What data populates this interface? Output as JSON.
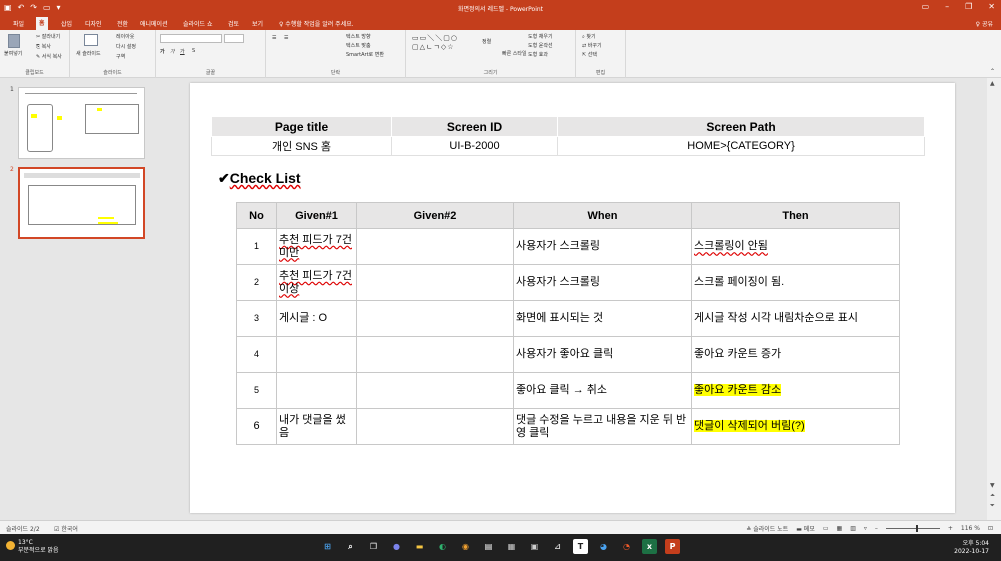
{
  "window": {
    "title": "화면정의서 레드벨 - PowerPoint"
  },
  "ribbon_tabs": [
    "파일",
    "홈",
    "삽입",
    "디자인",
    "전환",
    "애니메이션",
    "슬라이드 쇼",
    "검토",
    "보기"
  ],
  "tell_me": "♀ 수행할 작업을 알려 주세요.",
  "share": "♀ 공유",
  "ribbon": {
    "clipboard": {
      "label": "클립보드",
      "paste": "붙여넣기",
      "cut": "잘라내기",
      "copy": "복사",
      "format": "서식 복사"
    },
    "slides": {
      "label": "슬라이드",
      "new": "새 슬라이드",
      "layout": "레이아웃",
      "reset": "다시 설정",
      "section": "구역"
    },
    "font": {
      "label": "글꼴"
    },
    "paragraph": {
      "label": "단락",
      "text_direction": "텍스트 방향",
      "align_text": "텍스트 맞춤",
      "smartart": "SmartArt로 변환"
    },
    "drawing": {
      "label": "그리기",
      "arrange": "정렬",
      "quick_styles": "빠른 스타일",
      "fill": "도형 채우기",
      "outline": "도형 윤곽선",
      "effects": "도형 효과"
    },
    "editing": {
      "label": "편집",
      "find": "찾기",
      "replace": "바꾸기",
      "select": "선택"
    }
  },
  "thumbnails": [
    {
      "num": "1"
    },
    {
      "num": "2"
    }
  ],
  "slide": {
    "header_table": {
      "headers": [
        "Page title",
        "Screen ID",
        "Screen Path"
      ],
      "values": [
        "개인 SNS 홈",
        "UI-B-2000",
        "HOME>{CATEGORY}"
      ]
    },
    "checklist_title": "Check List",
    "checklist_mark": "✔",
    "checklist": {
      "headers": [
        "No",
        "Given#1",
        "Given#2",
        "When",
        "Then"
      ],
      "rows": [
        {
          "no": "1",
          "given1": "추천 피드가 7건 미만",
          "given2": "",
          "when": "사용자가 스크롤링",
          "then": "스크롤링이 안됨"
        },
        {
          "no": "2",
          "given1": "추천 피드가 7건 이상",
          "given2": "",
          "when": "사용자가 스크롤링",
          "then": "스크롤 페이징이 됨."
        },
        {
          "no": "3",
          "given1": "게시글 : O",
          "given2": "",
          "when": "화면에 표시되는 것",
          "then": "게시글 작성 시각 내림차순으로 표시"
        },
        {
          "no": "4",
          "given1": "",
          "given2": "",
          "when": "사용자가 좋아요 클릭",
          "then": "좋아요 카운트 증가"
        },
        {
          "no": "5",
          "given1": "",
          "given2": "",
          "when": "좋아요 클릭 → 취소",
          "then": "좋아요 카운트 감소"
        },
        {
          "no": "6",
          "given1": "내가 댓글을 썼음",
          "given2": "",
          "when": "댓글 수정을 누르고 내용을 지운 뒤 반영 클릭",
          "then": "댓글이 삭제되어 버림(?)"
        }
      ]
    }
  },
  "statusbar": {
    "slide_info": "슬라이드 2/2",
    "language": "한국어",
    "notes": "슬라이드 노트",
    "comments": "메모",
    "zoom": "116 %"
  },
  "taskbar": {
    "temp": "13°C",
    "weather": "부분적으로 맑음",
    "time": "오후 5:04",
    "date": "2022-10-17"
  },
  "colors": {
    "accent": "#c43e1c",
    "highlight": "#ffff00",
    "header_fill": "#e7e6e6"
  }
}
